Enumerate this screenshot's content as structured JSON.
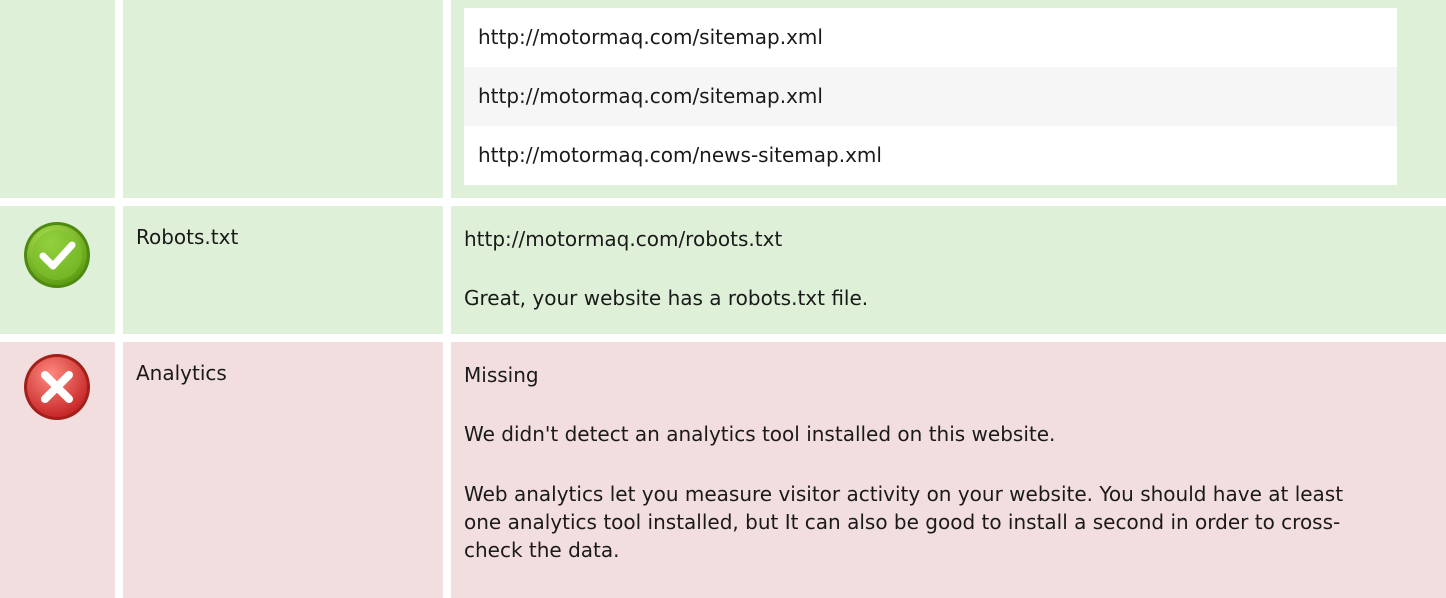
{
  "sitemap": {
    "urls": [
      "http://motormaq.com/sitemap.xml",
      "http://motormaq.com/sitemap.xml",
      "http://motormaq.com/news-sitemap.xml"
    ]
  },
  "robots": {
    "status_icon": "check-icon",
    "status_color": "#7cc22b",
    "label": "Robots.txt",
    "url": "http://motormaq.com/robots.txt",
    "message": "Great, your website has a robots.txt file."
  },
  "analytics": {
    "status_icon": "error-x-icon",
    "status_color": "#e2413c",
    "label": "Analytics",
    "status": "Missing",
    "message": "We didn't detect an analytics tool installed on this website.",
    "advice": "Web analytics let you measure visitor activity on your website. You should have at least one analytics tool installed, but It can also be good to install a second in order to cross-check the data."
  }
}
